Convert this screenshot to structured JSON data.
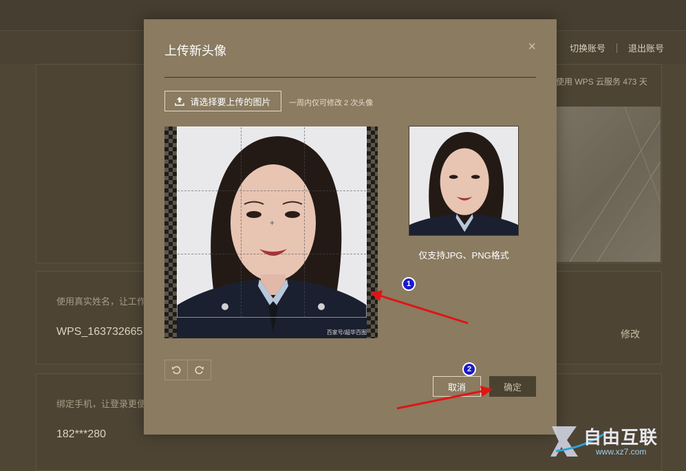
{
  "header": {
    "switch_account": "切换账号",
    "logout": "退出账号"
  },
  "background": {
    "cloud_days": "使用 WPS 云服务 473 天",
    "realname_hint": "使用真实姓名，让工作",
    "username": "WPS_163732665",
    "edit_link": "修改",
    "phone_hint": "绑定手机，让登录更便",
    "phone": "182***280"
  },
  "dialog": {
    "title": "上传新头像",
    "close": "×",
    "choose_label": "请选择要上传的图片",
    "limit_note": "一周内仅可修改 2 次头像",
    "photo_watermark": "百家号/超华百图",
    "format_note": "仅支持JPG、PNG格式",
    "cancel_label": "取消",
    "ok_label": "确定"
  },
  "annotations": {
    "badge1": "1",
    "badge2": "2",
    "arrow_color": "#e01414"
  },
  "logo": {
    "text": "自由互联",
    "url": "www.xz7.com"
  },
  "colors": {
    "dialog_bg": "#8a7b61",
    "page_bg": "#4f4636",
    "badge_bg": "#1a1acc"
  }
}
